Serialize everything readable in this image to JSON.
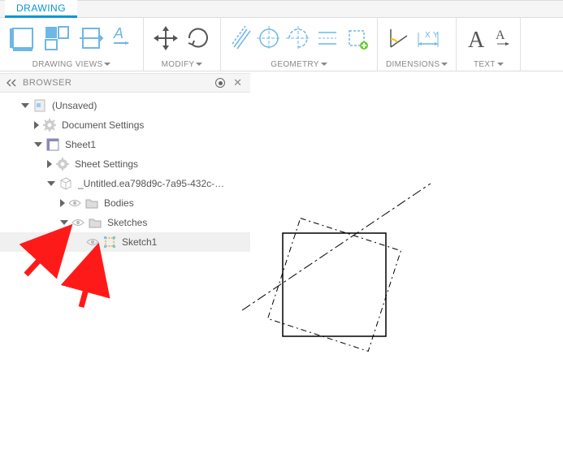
{
  "tab": {
    "active_label": "DRAWING"
  },
  "ribbon": {
    "groups": [
      {
        "label": "DRAWING VIEWS"
      },
      {
        "label": "MODIFY"
      },
      {
        "label": "GEOMETRY"
      },
      {
        "label": "DIMENSIONS"
      },
      {
        "label": "TEXT"
      }
    ]
  },
  "browser": {
    "title": "BROWSER",
    "root": {
      "label": "(Unsaved)",
      "children": [
        {
          "label": "Document Settings"
        },
        {
          "label": "Sheet1",
          "children": [
            {
              "label": "Sheet Settings"
            },
            {
              "label": "_Untitled.ea798d9c-7a95-432c-…",
              "children": [
                {
                  "label": "Bodies"
                },
                {
                  "label": "Sketches",
                  "children": [
                    {
                      "label": "Sketch1"
                    }
                  ]
                }
              ]
            }
          ]
        }
      ]
    }
  }
}
